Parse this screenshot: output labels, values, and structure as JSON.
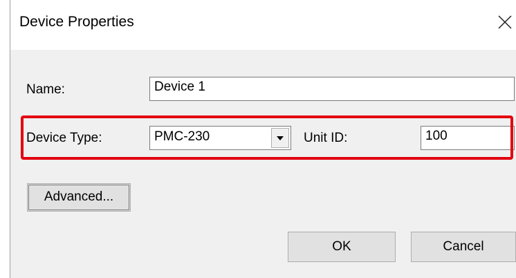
{
  "dialog": {
    "title": "Device Properties",
    "close_glyph": "✕"
  },
  "name_row": {
    "label": "Name:",
    "value": "Device 1"
  },
  "device_row": {
    "type_label": "Device Type:",
    "type_value": "PMC-230",
    "dropdown_icon": "chevron-down-icon",
    "unit_label": "Unit ID:",
    "unit_value": "100"
  },
  "buttons": {
    "advanced": "Advanced...",
    "ok": "OK",
    "cancel": "Cancel"
  },
  "colors": {
    "highlight": "#e3000f",
    "dialog_bg": "#f0f0f0",
    "button_bg": "#e1e1e1"
  }
}
